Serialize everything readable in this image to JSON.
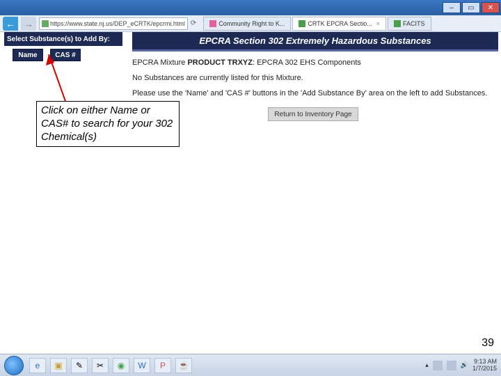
{
  "browser": {
    "url": "https://www.state.nj.us/DEP_eCRTK/epcrmi.html",
    "tabs": [
      {
        "label": "Community Right to K..."
      },
      {
        "label": "CRTK EPCRA Sectio..."
      },
      {
        "label": "FACITS"
      }
    ]
  },
  "sidebar": {
    "header": "Select Substance(s) to Add By:",
    "buttons": {
      "name": "Name",
      "cas": "CAS #"
    }
  },
  "banner": "EPCRA Section 302 Extremely Hazardous Substances",
  "content": {
    "mixture_prefix": "EPCRA Mixture ",
    "mixture_bold": "PRODUCT TRXYZ",
    "mixture_suffix": ":   EPCRA 302 EHS Components",
    "no_subs": "No Substances are currently listed for this Mixture.",
    "instr": "Please use the 'Name' and 'CAS #' buttons in the 'Add Substance By' area on the left to add Substances.",
    "return_btn": "Return to Inventory Page"
  },
  "callout": "Click on either Name or CAS# to search for your 302 Chemical(s)",
  "page_number": "39",
  "taskbar": {
    "time": "9:13 AM",
    "date": "1/7/2015"
  }
}
